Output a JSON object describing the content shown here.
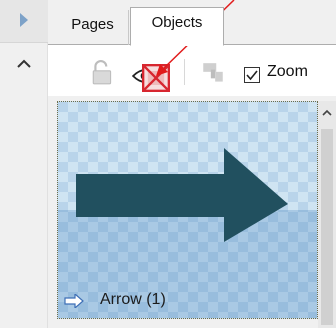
{
  "tabs": {
    "pages_label": "Pages",
    "objects_label": "Objects",
    "selected": "Objects"
  },
  "toolbar": {
    "lock_icon": "unlock-icon",
    "visibility_icon": "eye-icon",
    "hide_icon": "hide-object-icon",
    "format_icon": "copy-format-icon",
    "zoom_label": "Zoom",
    "zoom_checked": true
  },
  "objects": {
    "items": [
      {
        "label": "Arrow (1)",
        "icon": "arrow-shape-icon"
      }
    ]
  },
  "colors": {
    "arrow_fill": "#21505f",
    "tile_bg": "#cfe3f3",
    "annotation_red": "#e11b1b",
    "hide_icon_red": "#d7262f"
  }
}
